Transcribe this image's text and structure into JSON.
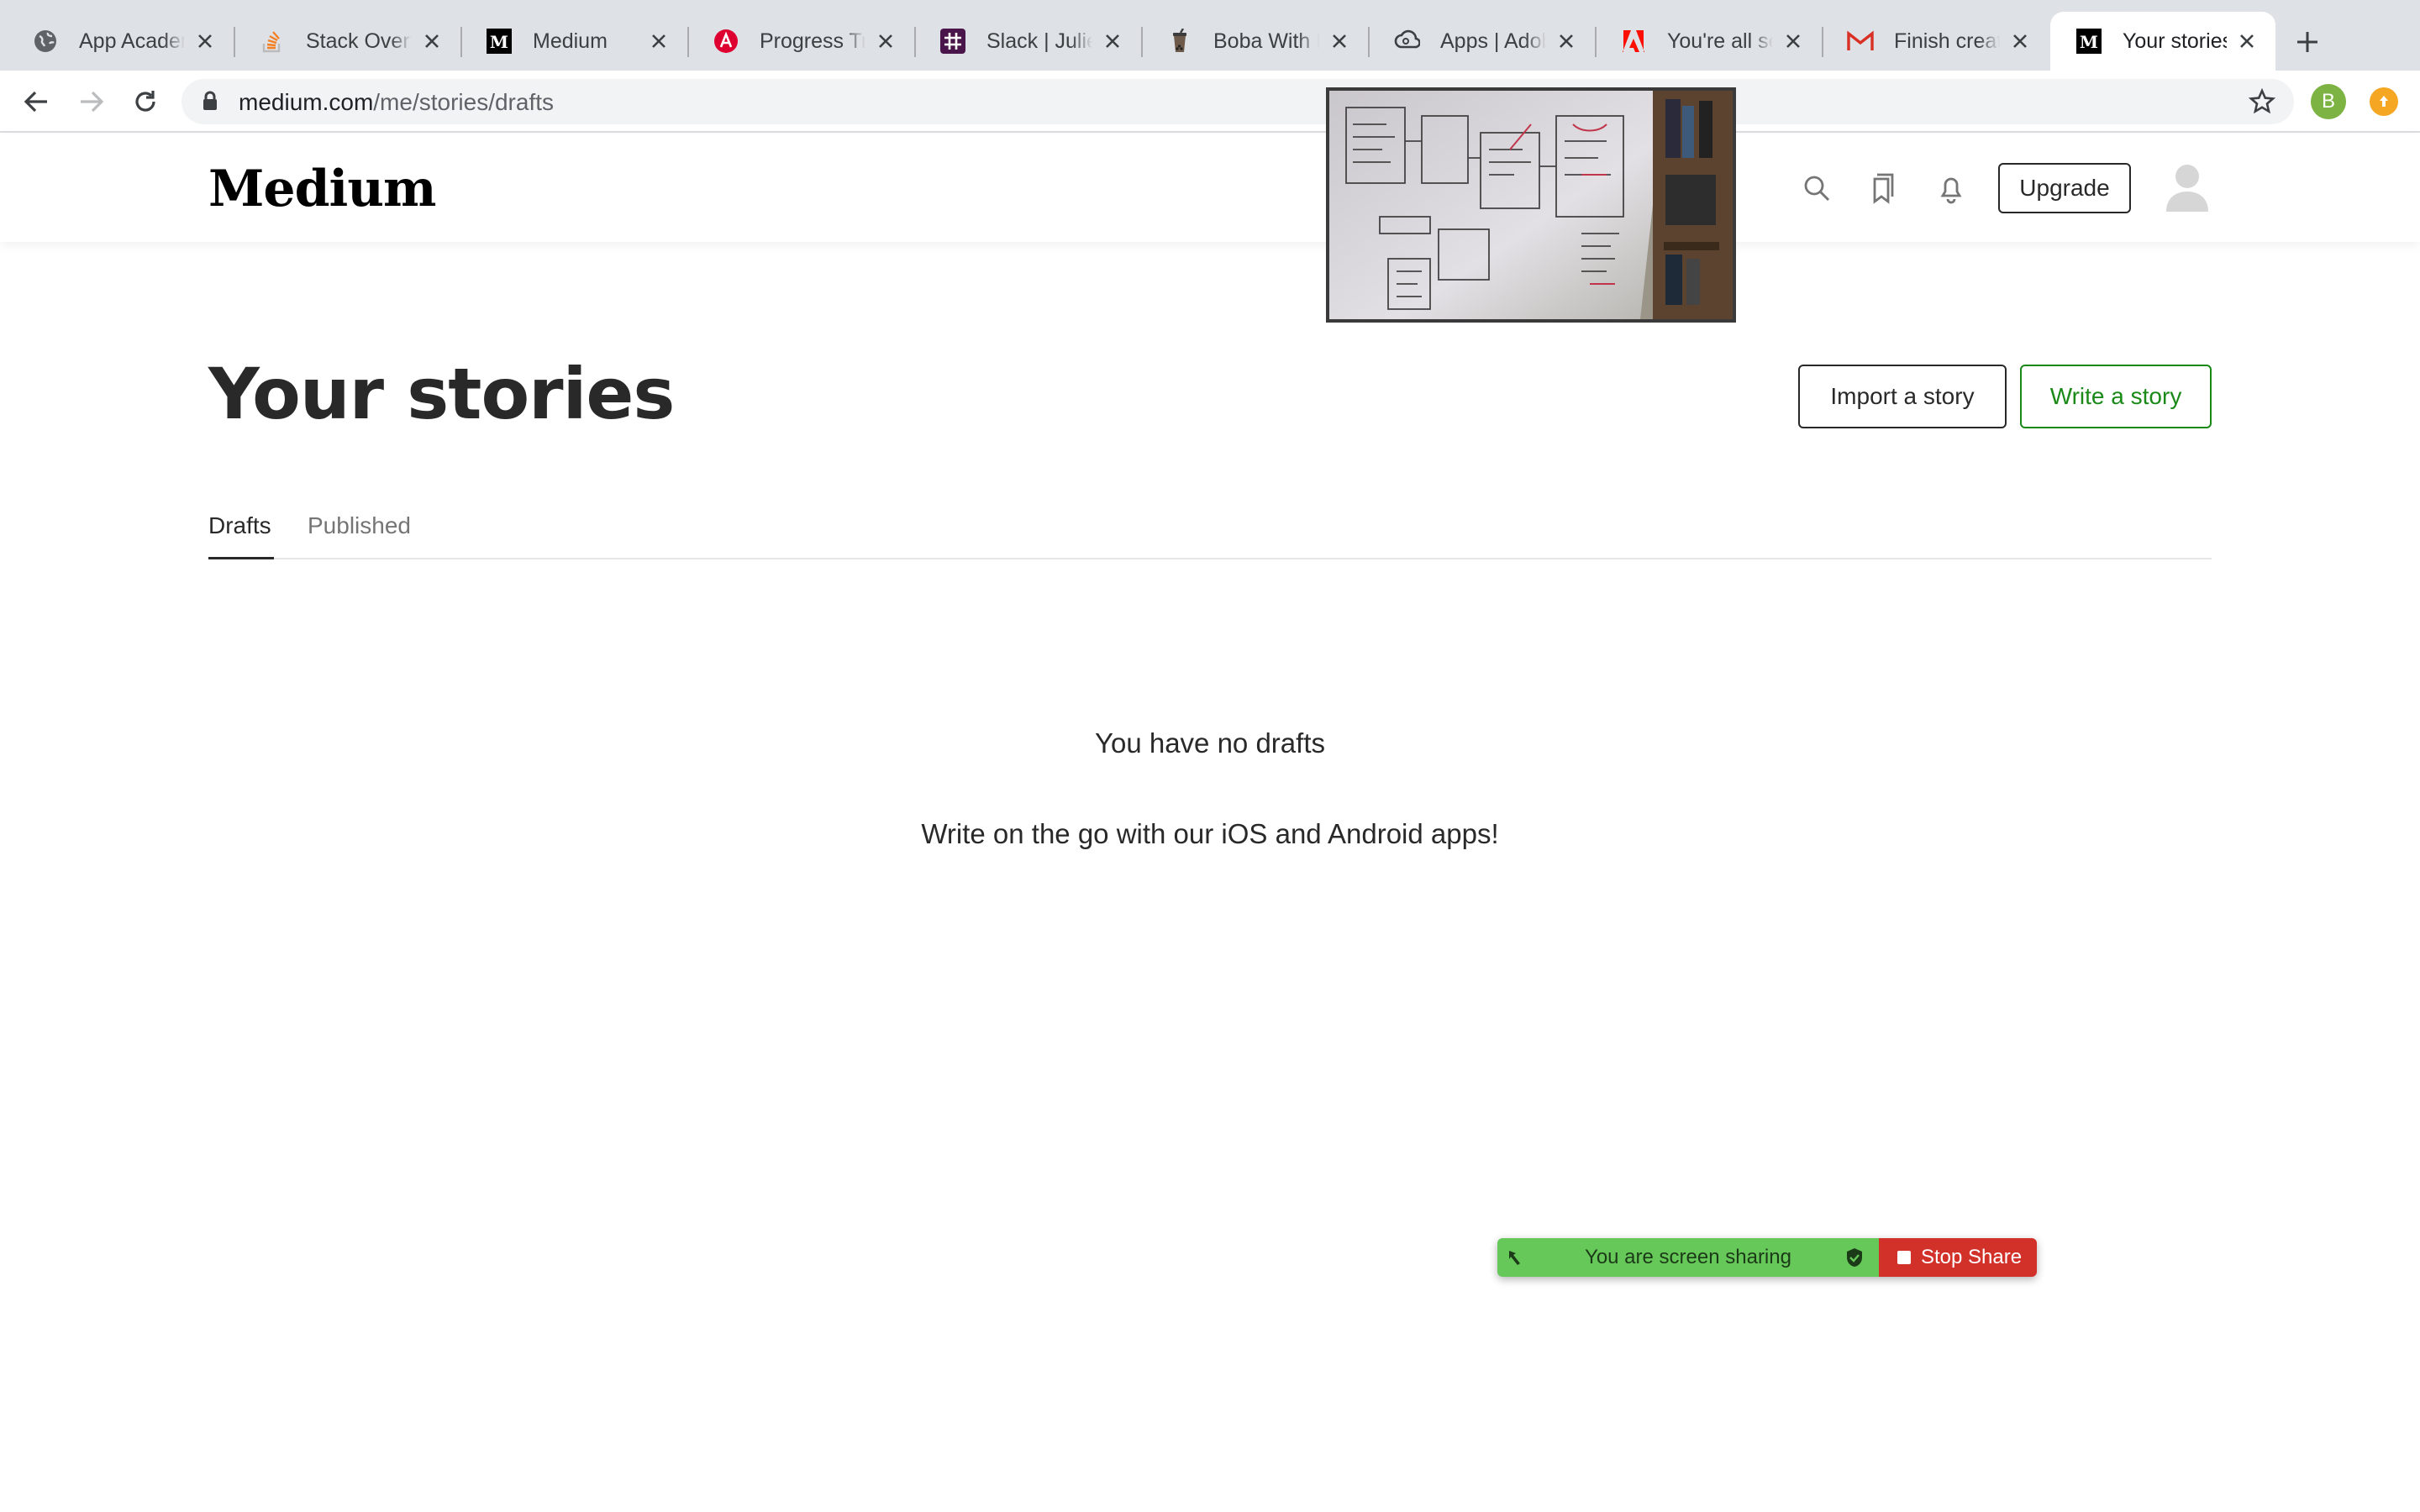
{
  "browser": {
    "tabs": [
      {
        "title": "App Academy",
        "icon": "globe-icon"
      },
      {
        "title": "Stack Overflow",
        "icon": "stackoverflow-icon"
      },
      {
        "title": "Medium",
        "icon": "medium-icon"
      },
      {
        "title": "Progress Tracker",
        "icon": "angular-icon"
      },
      {
        "title": "Slack | Juliet",
        "icon": "slack-icon"
      },
      {
        "title": "Boba With B",
        "icon": "boba-icon"
      },
      {
        "title": "Apps | Adobe",
        "icon": "creative-cloud-icon"
      },
      {
        "title": "You're all set",
        "icon": "adobe-icon"
      },
      {
        "title": "Finish creating",
        "icon": "gmail-icon"
      },
      {
        "title": "Your stories",
        "icon": "medium-icon",
        "active": true
      }
    ],
    "url": {
      "domain": "medium.com",
      "path": "/me/stories/drafts"
    },
    "profile_initial": "B"
  },
  "header": {
    "logo": "Medium",
    "upgrade_label": "Upgrade"
  },
  "main": {
    "title": "Your stories",
    "import_label": "Import a story",
    "write_label": "Write a story",
    "tabs": [
      {
        "label": "Drafts",
        "active": true
      },
      {
        "label": "Published",
        "active": false
      }
    ],
    "empty_title": "You have no drafts",
    "empty_subtitle": "Write on the go with our iOS and Android apps!"
  },
  "share_bar": {
    "status": "You are screen sharing",
    "stop_label": "Stop Share"
  },
  "colors": {
    "accent_green": "#1a8917",
    "share_green": "#67c85a",
    "share_red": "#d2312a"
  }
}
